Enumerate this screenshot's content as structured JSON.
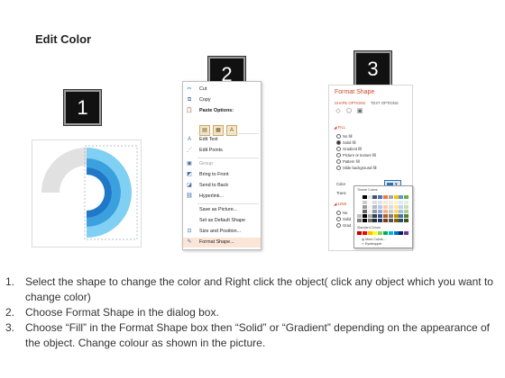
{
  "title": "Edit Color",
  "steps": {
    "one": "1",
    "two": "2",
    "three": "3"
  },
  "context_menu": {
    "items": [
      {
        "icon": "scissors-icon",
        "glyph": "✂",
        "label": "Cut",
        "dim": false
      },
      {
        "icon": "copy-icon",
        "glyph": "⧉",
        "label": "Copy",
        "dim": false
      },
      {
        "icon": "clipboard-icon",
        "glyph": "📋",
        "label": "Paste Options:",
        "dim": false
      },
      {
        "icon": "edit-text-icon",
        "glyph": "A",
        "label": "Edit Text",
        "dim": false
      },
      {
        "icon": "edit-points-icon",
        "glyph": "⋰",
        "label": "Edit Points",
        "dim": false
      },
      {
        "icon": "group-icon",
        "glyph": "▣",
        "label": "Group",
        "dim": true
      },
      {
        "icon": "bring-front-icon",
        "glyph": "◩",
        "label": "Bring to Front",
        "dim": false
      },
      {
        "icon": "send-back-icon",
        "glyph": "◪",
        "label": "Send to Back",
        "dim": false
      },
      {
        "icon": "hyperlink-icon",
        "glyph": "⛓",
        "label": "Hyperlink...",
        "dim": false
      },
      {
        "icon": "save-picture-icon",
        "glyph": "",
        "label": "Save as Picture...",
        "dim": false
      },
      {
        "icon": "default-shape-icon",
        "glyph": "",
        "label": "Set as Default Shape",
        "dim": false
      },
      {
        "icon": "size-position-icon",
        "glyph": "⊡",
        "label": "Size and Position...",
        "dim": false
      },
      {
        "icon": "format-shape-icon",
        "glyph": "✎",
        "label": "Format Shape...",
        "dim": false
      }
    ]
  },
  "format_pane": {
    "title": "Format Shape",
    "tab_shape": "SHAPE OPTIONS",
    "tab_text": "TEXT OPTIONS",
    "section_fill": "FILL",
    "options": [
      "No fill",
      "Solid fill",
      "Gradient fill",
      "Picture or texture fill",
      "Pattern fill",
      "Slide background fill"
    ],
    "selected_option": 1,
    "color_label": "Color",
    "trans_label": "Trans",
    "section_line": "LINE",
    "line_options": [
      "No",
      "Solid",
      "Grad"
    ]
  },
  "palette": {
    "theme_label": "Theme Colors",
    "standard_label": "Standard Colors",
    "more_label": "More Colors...",
    "eyedropper_label": "Eyedropper",
    "theme_colors": [
      "#ffffff",
      "#000000",
      "#e7e6e6",
      "#44546a",
      "#4472c4",
      "#ed7d31",
      "#a5a5a5",
      "#ffc000",
      "#5b9bd5",
      "#70ad47"
    ],
    "standard_colors": [
      "#c00000",
      "#ff0000",
      "#ffc000",
      "#ffff00",
      "#92d050",
      "#00b050",
      "#00b0f0",
      "#0070c0",
      "#002060",
      "#7030a0"
    ],
    "accent": "#2e75b6"
  },
  "instructions": [
    {
      "num": "1.",
      "text": "Select the shape to change the color and Right click the object( click any object which you want to change color)"
    },
    {
      "num": "2.",
      "text": "Choose Format Shape in the dialog box."
    },
    {
      "num": "3.",
      "text": "Choose “Fill” in the Format Shape box then “Solid” or “Gradient” depending on the appearance of the object. Change colour as shown in the picture."
    }
  ],
  "colors": {
    "ring_gray": "#e1e1e1",
    "ring_blue_1": "#1f78c8",
    "ring_blue_2": "#3aa0de",
    "ring_blue_3": "#7fd0f2",
    "accent_orange": "#d24726"
  }
}
